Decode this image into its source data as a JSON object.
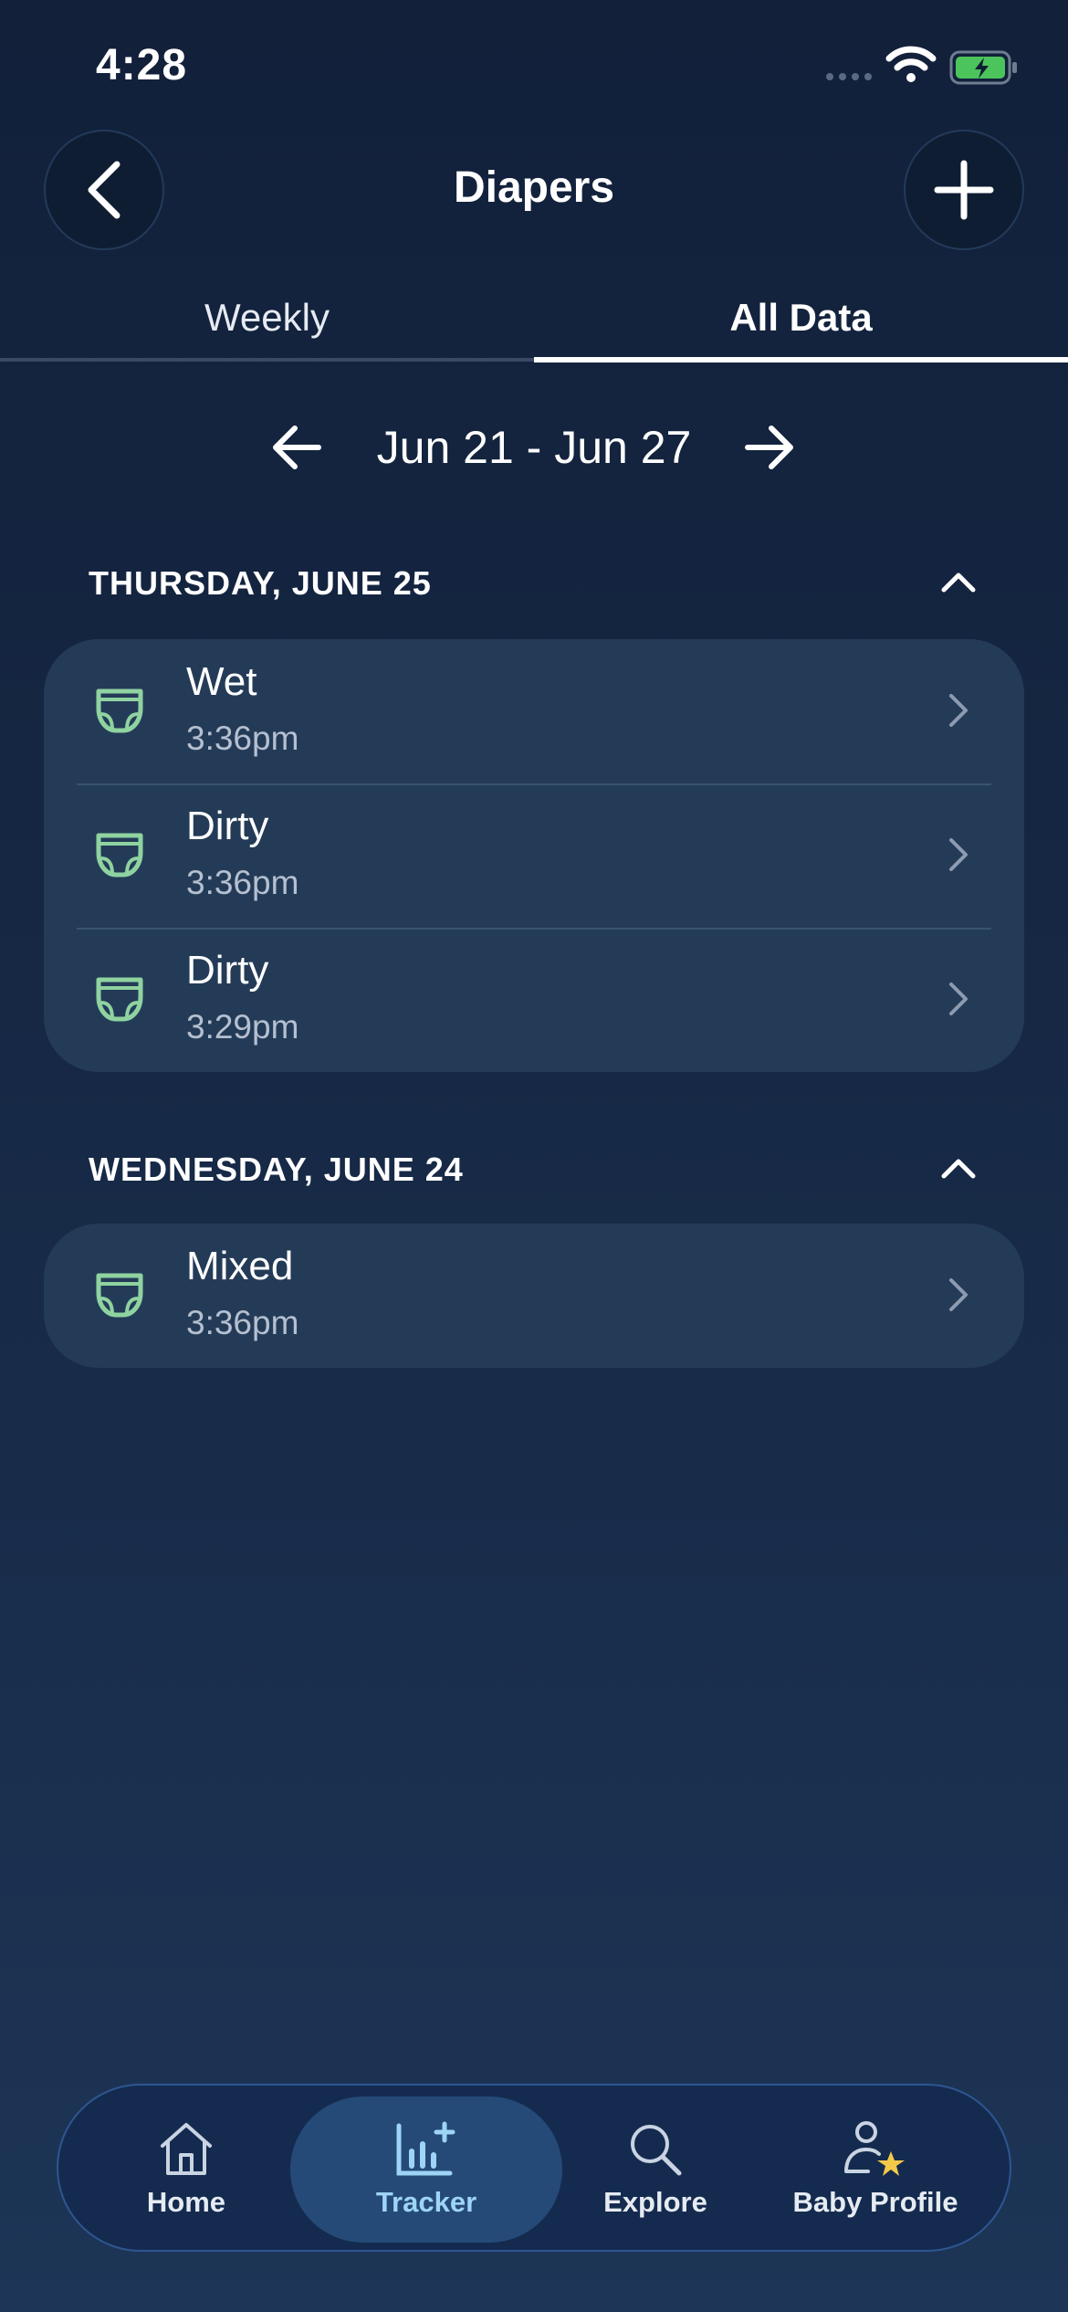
{
  "status_bar": {
    "time": "4:28"
  },
  "header": {
    "title": "Diapers"
  },
  "tabs": [
    {
      "label": "Weekly",
      "active": false
    },
    {
      "label": "All Data",
      "active": true
    }
  ],
  "week_range": "Jun 21 - Jun 27",
  "sections": [
    {
      "title": "THURSDAY, JUNE 25",
      "entries": [
        {
          "type": "Wet",
          "time": "3:36pm"
        },
        {
          "type": "Dirty",
          "time": "3:36pm"
        },
        {
          "type": "Dirty",
          "time": "3:29pm"
        }
      ]
    },
    {
      "title": "WEDNESDAY, JUNE 24",
      "entries": [
        {
          "type": "Mixed",
          "time": "3:36pm"
        }
      ]
    }
  ],
  "bottom_nav": [
    {
      "label": "Home",
      "icon": "home-icon",
      "active": false
    },
    {
      "label": "Tracker",
      "icon": "tracker-icon",
      "active": true
    },
    {
      "label": "Explore",
      "icon": "search-icon",
      "active": false
    },
    {
      "label": "Baby Profile",
      "icon": "baby-profile-icon",
      "active": false
    }
  ],
  "colors": {
    "background": "#12203a",
    "card": "#243b58",
    "diaper_icon": "#8fd3a0",
    "tracker_active": "#9ed4f5",
    "star": "#f3c94a"
  }
}
